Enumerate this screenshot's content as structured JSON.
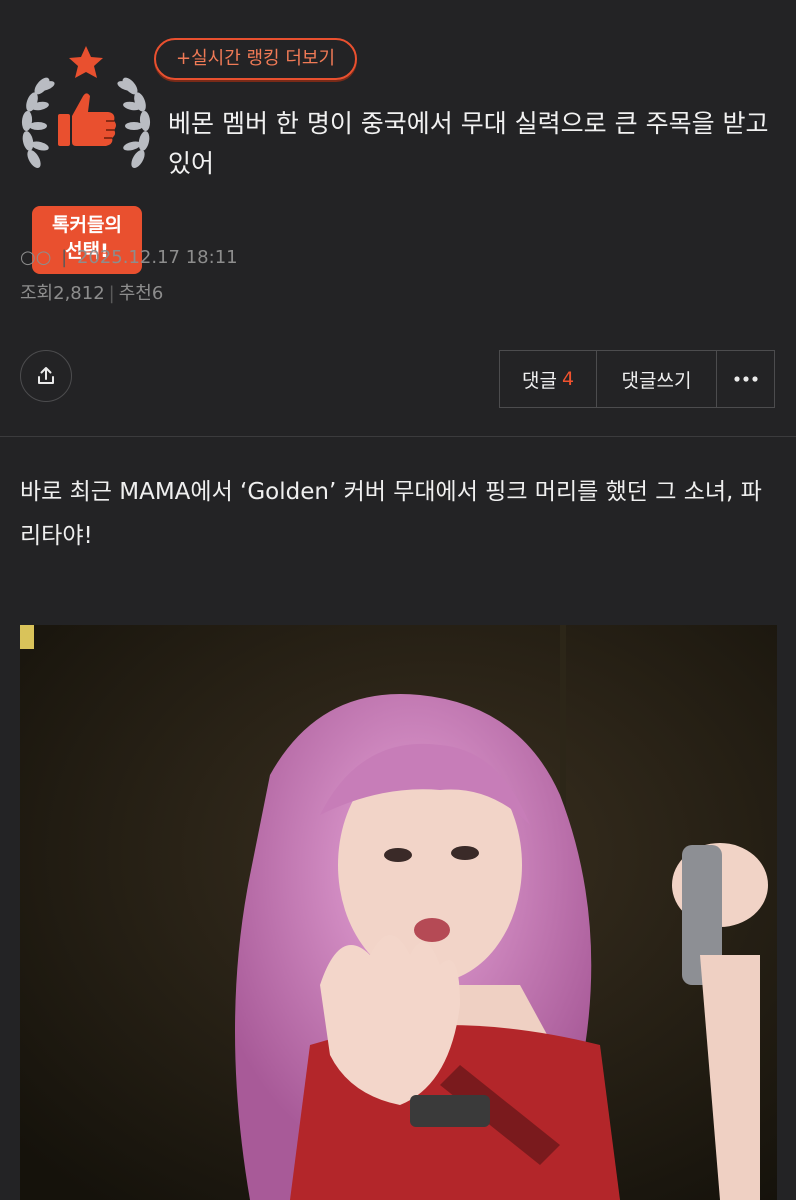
{
  "badge": {
    "label_line1": "톡커들의",
    "label_line2": "선택!"
  },
  "ranking": {
    "link_label": "+실시간 랭킹 더보기"
  },
  "post": {
    "title": "베몬 멤버 한 명이 중국에서 무대 실력으로 큰 주목을 받고 있어",
    "author": "○○",
    "datetime": "2025.12.17 18:11",
    "views_label": "조회",
    "views": "2,812",
    "recommend_label": "추천",
    "recommend": "6",
    "body": "바로 최근 MAMA에서 ‘Golden’ 커버 무대에서 핑크 머리를 했던 그 소녀, 파리타야!"
  },
  "actions": {
    "comments_label": "댓글",
    "comments_count": "4",
    "write_comment_label": "댓글쓰기"
  },
  "icons": {
    "share": "share-icon",
    "more": "more-dots-icon",
    "thumbs_up": "thumbs-up-icon",
    "star": "star-icon"
  },
  "colors": {
    "background": "#232325",
    "accent": "#e9502f",
    "count": "#f0522e",
    "muted": "#8d8d8d"
  }
}
